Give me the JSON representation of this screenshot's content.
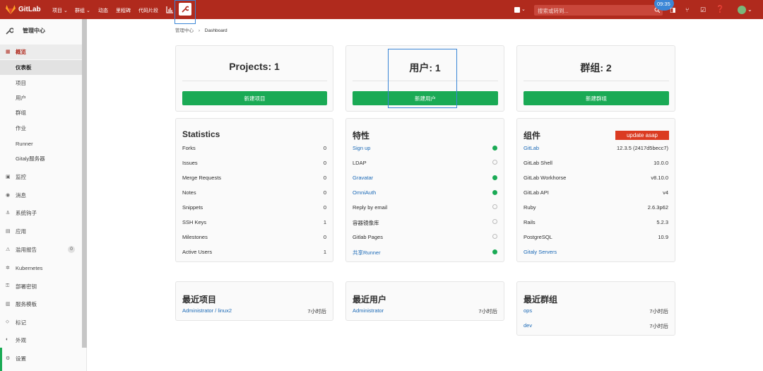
{
  "topbar": {
    "brand": "GitLab",
    "nav": [
      "项目 ⌄",
      "群组 ⌄",
      "动态",
      "里程碑",
      "代码片段"
    ],
    "search_placeholder": "搜索或转到...",
    "clock": "09:35"
  },
  "sidebar": {
    "title": "管理中心",
    "items": [
      {
        "label": "概览",
        "icon": "grid-icon",
        "active": true
      },
      {
        "label": "仪表板",
        "sub": true,
        "current": true
      },
      {
        "label": "项目",
        "sub": true
      },
      {
        "label": "用户",
        "sub": true
      },
      {
        "label": "群组",
        "sub": true
      },
      {
        "label": "作业",
        "sub": true
      },
      {
        "label": "Runner",
        "sub": true
      },
      {
        "label": "Gitaly服务器",
        "sub": true
      },
      {
        "label": "监控",
        "icon": "monitor-icon"
      },
      {
        "label": "消息",
        "icon": "broadcast-icon"
      },
      {
        "label": "系统钩子",
        "icon": "hook-icon"
      },
      {
        "label": "应用",
        "icon": "applications-icon"
      },
      {
        "label": "滥用报告",
        "icon": "abuse-icon",
        "count": "0"
      },
      {
        "label": "Kubernetes",
        "icon": "kubernetes-icon"
      },
      {
        "label": "部署密钥",
        "icon": "key-icon"
      },
      {
        "label": "服务模板",
        "icon": "template-icon"
      },
      {
        "label": "标记",
        "icon": "label-icon"
      },
      {
        "label": "外观",
        "icon": "appearance-icon"
      },
      {
        "label": "设置",
        "icon": "settings-icon"
      }
    ]
  },
  "breadcrumb": {
    "root": "管理中心",
    "current": "Dashboard"
  },
  "counts": [
    {
      "title": "Projects: 1",
      "button": "新建项目"
    },
    {
      "title": "用户: 1",
      "button": "新建用户"
    },
    {
      "title": "群组: 2",
      "button": "新建群组"
    }
  ],
  "statistics": {
    "title": "Statistics",
    "rows": [
      {
        "label": "Forks",
        "value": "0"
      },
      {
        "label": "Issues",
        "value": "0"
      },
      {
        "label": "Merge Requests",
        "value": "0"
      },
      {
        "label": "Notes",
        "value": "0"
      },
      {
        "label": "Snippets",
        "value": "0"
      },
      {
        "label": "SSH Keys",
        "value": "1"
      },
      {
        "label": "Milestones",
        "value": "0"
      },
      {
        "label": "Active Users",
        "value": "1"
      }
    ]
  },
  "features": {
    "title": "特性",
    "rows": [
      {
        "label": "Sign up",
        "link": true,
        "on": true
      },
      {
        "label": "LDAP",
        "link": false,
        "on": false
      },
      {
        "label": "Gravatar",
        "link": true,
        "on": true
      },
      {
        "label": "OmniAuth",
        "link": true,
        "on": true
      },
      {
        "label": "Reply by email",
        "link": false,
        "on": false
      },
      {
        "label": "容器镜像库",
        "link": false,
        "on": false
      },
      {
        "label": "Gitlab Pages",
        "link": false,
        "on": false
      },
      {
        "label": "共享Runner",
        "link": true,
        "on": true
      }
    ]
  },
  "components": {
    "title": "组件",
    "badge": "update asap",
    "rows": [
      {
        "label": "GitLab",
        "value": "12.3.5 (2417d5becc7)",
        "link": true
      },
      {
        "label": "GitLab Shell",
        "value": "10.0.0"
      },
      {
        "label": "GitLab Workhorse",
        "value": "v8.10.0"
      },
      {
        "label": "GitLab API",
        "value": "v4"
      },
      {
        "label": "Ruby",
        "value": "2.6.3p62"
      },
      {
        "label": "Rails",
        "value": "5.2.3"
      },
      {
        "label": "PostgreSQL",
        "value": "10.9"
      },
      {
        "label": "Gitaly Servers",
        "value": "",
        "link": true
      }
    ]
  },
  "latest_projects": {
    "title": "最近项目",
    "rows": [
      {
        "label": "Administrator / linux2",
        "time": "7小时后"
      }
    ]
  },
  "latest_users": {
    "title": "最近用户",
    "rows": [
      {
        "label": "Administrator",
        "time": "7小时后"
      }
    ]
  },
  "latest_groups": {
    "title": "最近群组",
    "rows": [
      {
        "label": "ops",
        "time": "7小时后"
      },
      {
        "label": "dev",
        "time": "7小时后"
      }
    ]
  },
  "colors": {
    "topbar": "#b02a1d",
    "green": "#1aaa55",
    "link": "#1b69b6",
    "badge": "#db3b21"
  }
}
